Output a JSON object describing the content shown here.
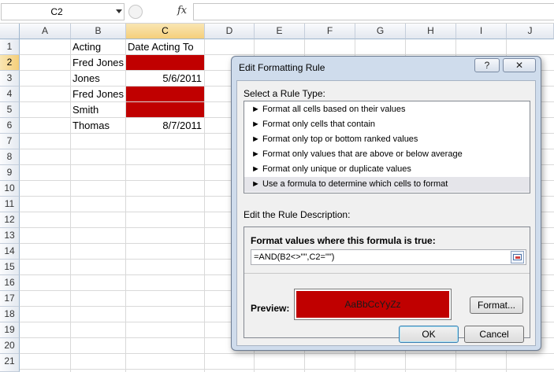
{
  "formula_bar": {
    "name_box": "C2",
    "fx_symbol": "fx",
    "formula": ""
  },
  "columns": [
    "A",
    "B",
    "C",
    "D",
    "E",
    "F",
    "G",
    "H",
    "I",
    "J"
  ],
  "rows": [
    "1",
    "2",
    "3",
    "4",
    "5",
    "6",
    "7",
    "8",
    "9",
    "10",
    "11",
    "12",
    "13",
    "14",
    "15",
    "16",
    "17",
    "18",
    "19",
    "20",
    "21"
  ],
  "selected_cell": "C2",
  "cells": {
    "B1": "Acting",
    "C1": "Date Acting To",
    "B2": "Fred Jones",
    "B3": "Jones",
    "C3": "5/6/2011",
    "B4": "Fred Jones",
    "B5": "Smith",
    "B6": "Thomas",
    "C6": "8/7/2011"
  },
  "highlight_color": "#c00000",
  "dialog": {
    "title": "Edit Formatting Rule",
    "help_label": "?",
    "close_label": "✕",
    "select_rule_type_label": "Select a Rule Type:",
    "rule_types": [
      "► Format all cells based on their values",
      "► Format only cells that contain",
      "► Format only top or bottom ranked values",
      "► Format only values that are above or below average",
      "► Format only unique or duplicate values",
      "► Use a formula to determine which cells to format"
    ],
    "selected_rule_index": 5,
    "edit_description_label": "Edit the Rule Description:",
    "formula_heading": "Format values where this formula is true:",
    "formula_value": "=AND(B2<>\"\",C2=\"\")",
    "preview_label": "Preview:",
    "preview_text": "AaBbCcYyZz",
    "format_button": "Format...",
    "ok_button": "OK",
    "cancel_button": "Cancel"
  }
}
